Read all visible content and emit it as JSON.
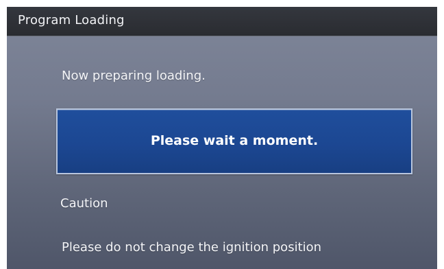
{
  "window": {
    "title": "Program Loading"
  },
  "main": {
    "status": "Now preparing loading.",
    "wait_message": "Please wait a moment.",
    "caution_title": "Caution",
    "caution_text": "Please do not change the ignition position"
  },
  "colors": {
    "header_bg": "#2a2c31",
    "screen_bg_top": "#7f8699",
    "screen_bg_bottom": "#4f5669",
    "wait_box_bg": "#1c4792",
    "wait_box_border": "#b9c6dd",
    "text": "#f4f5f8"
  }
}
